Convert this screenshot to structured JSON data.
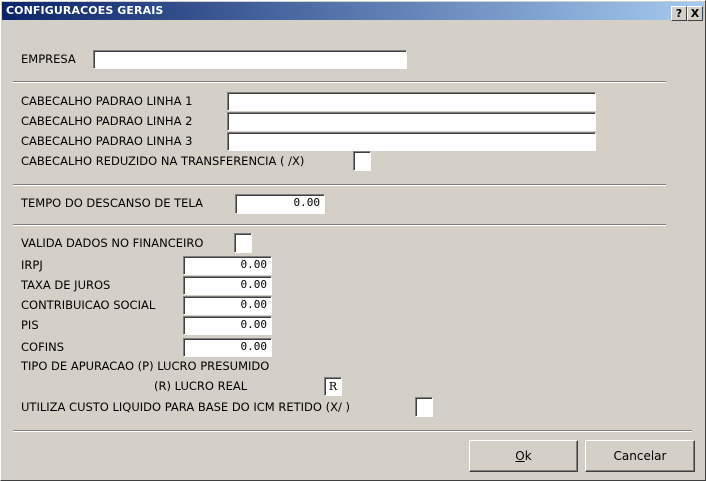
{
  "window": {
    "title": "CONFIGURACOES GERAIS",
    "help_button": "?",
    "close_button": "X"
  },
  "empresa": {
    "label": "EMPRESA",
    "value": ""
  },
  "cabecalho": {
    "linha1_label": "CABECALHO PADRAO LINHA 1",
    "linha1_value": "",
    "linha2_label": "CABECALHO PADRAO LINHA 2",
    "linha2_value": "",
    "linha3_label": "CABECALHO PADRAO LINHA 3",
    "linha3_value": "",
    "reduzido_label": "CABECALHO REDUZIDO NA TRANSFERENCIA ( /X)",
    "reduzido_value": ""
  },
  "descanso": {
    "label": "TEMPO DO DESCANSO DE TELA",
    "value": "0.00"
  },
  "financeiro": {
    "valida_label": "VALIDA DADOS NO FINANCEIRO",
    "valida_value": "",
    "irpj_label": "IRPJ",
    "irpj_value": "0.00",
    "juros_label": "TAXA DE JUROS",
    "juros_value": "0.00",
    "contrib_label": "CONTRIBUICAO SOCIAL",
    "contrib_value": "0.00",
    "pis_label": "PIS",
    "pis_value": "0.00",
    "cofins_label": "COFINS",
    "cofins_value": "0.00",
    "apuracao_label1": "TIPO DE APURACAO (P) LUCRO PRESUMIDO",
    "apuracao_label2": "(R) LUCRO REAL",
    "apuracao_value": "R",
    "custo_label": "UTILIZA CUSTO LIQUIDO PARA BASE DO ICM RETIDO (X/ )",
    "custo_value": ""
  },
  "buttons": {
    "ok_mnemonic": "O",
    "ok_rest": "k",
    "cancel_label": "Cancelar"
  }
}
